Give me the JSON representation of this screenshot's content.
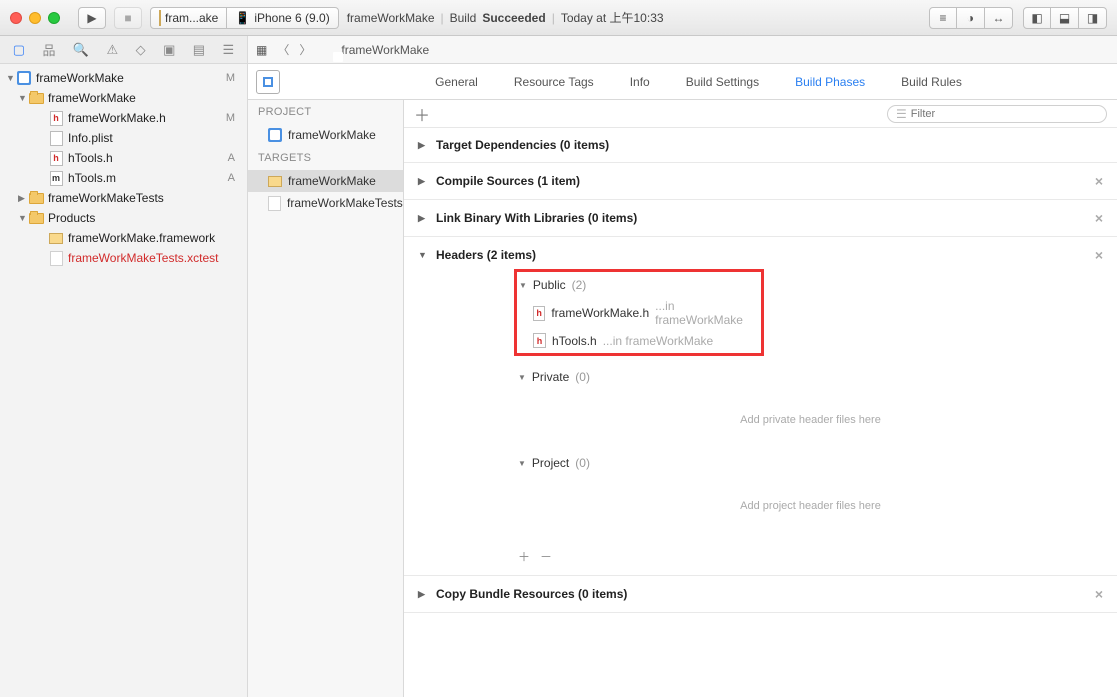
{
  "titlebar": {
    "scheme": "fram...ake",
    "device": "iPhone 6 (9.0)",
    "project": "frameWorkMake",
    "build_label": "Build",
    "build_status": "Succeeded",
    "time": "Today at 上午10:33"
  },
  "navigator": {
    "root": "frameWorkMake",
    "root_badge": "M",
    "group1": "frameWorkMake",
    "f_h": "frameWorkMake.h",
    "f_h_badge": "M",
    "f_plist": "Info.plist",
    "f_htools_h": "hTools.h",
    "f_htools_h_badge": "A",
    "f_htools_m": "hTools.m",
    "f_htools_m_badge": "A",
    "tests": "frameWorkMakeTests",
    "products": "Products",
    "prod_fw": "frameWorkMake.framework",
    "prod_test": "frameWorkMakeTests.xctest"
  },
  "jumpbar": {
    "item": "frameWorkMake"
  },
  "tabs": {
    "general": "General",
    "resource": "Resource Tags",
    "info": "Info",
    "build_settings": "Build Settings",
    "build_phases": "Build Phases",
    "build_rules": "Build Rules"
  },
  "pt": {
    "project_hdr": "PROJECT",
    "project": "frameWorkMake",
    "targets_hdr": "TARGETS",
    "t1": "frameWorkMake",
    "t2": "frameWorkMakeTests"
  },
  "filter": {
    "placeholder": "Filter"
  },
  "phases": {
    "deps": "Target Dependencies (0 items)",
    "compile": "Compile Sources (1 item)",
    "link": "Link Binary With Libraries (0 items)",
    "headers": "Headers (2 items)",
    "copy": "Copy Bundle Resources (0 items)"
  },
  "headers": {
    "public": "Public",
    "public_cnt": "(2)",
    "h1": "frameWorkMake.h",
    "h1_in": "...in frameWorkMake",
    "h2": "hTools.h",
    "h2_in": "...in frameWorkMake",
    "private": "Private",
    "private_cnt": "(0)",
    "private_drop": "Add private header files here",
    "project": "Project",
    "project_cnt": "(0)",
    "project_drop": "Add project header files here"
  }
}
